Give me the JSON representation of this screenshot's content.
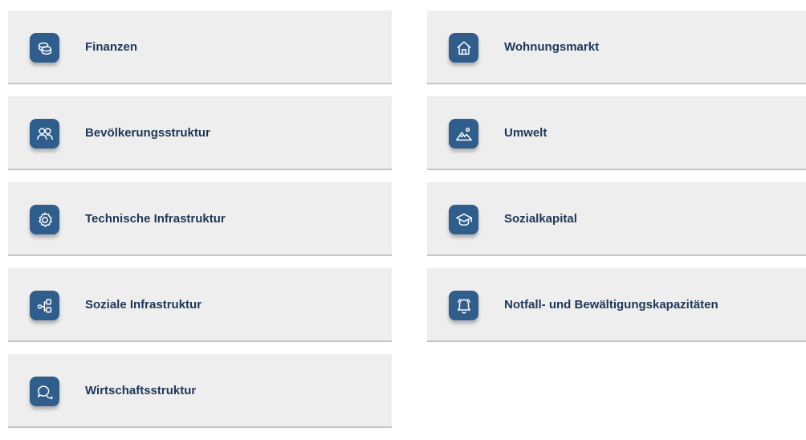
{
  "categories": {
    "left": [
      {
        "label": "Finanzen",
        "icon": "coins-icon"
      },
      {
        "label": "Bevölkerungsstruktur",
        "icon": "people-icon"
      },
      {
        "label": "Technische Infrastruktur",
        "icon": "gear-icon"
      },
      {
        "label": "Soziale Infrastruktur",
        "icon": "network-icon"
      },
      {
        "label": "Wirtschaftsstruktur",
        "icon": "chat-icon"
      }
    ],
    "right": [
      {
        "label": "Wohnungsmarkt",
        "icon": "house-icon"
      },
      {
        "label": "Umwelt",
        "icon": "landscape-icon"
      },
      {
        "label": "Sozialkapital",
        "icon": "graduation-cap-icon"
      },
      {
        "label": "Notfall- und Bewältigungskapazitäten",
        "icon": "bell-icon"
      }
    ]
  },
  "colors": {
    "tile_background": "#eeeeee",
    "icon_background": "#2f5d8c",
    "label_text": "#1e3656",
    "divider": "#c4c4c4"
  }
}
